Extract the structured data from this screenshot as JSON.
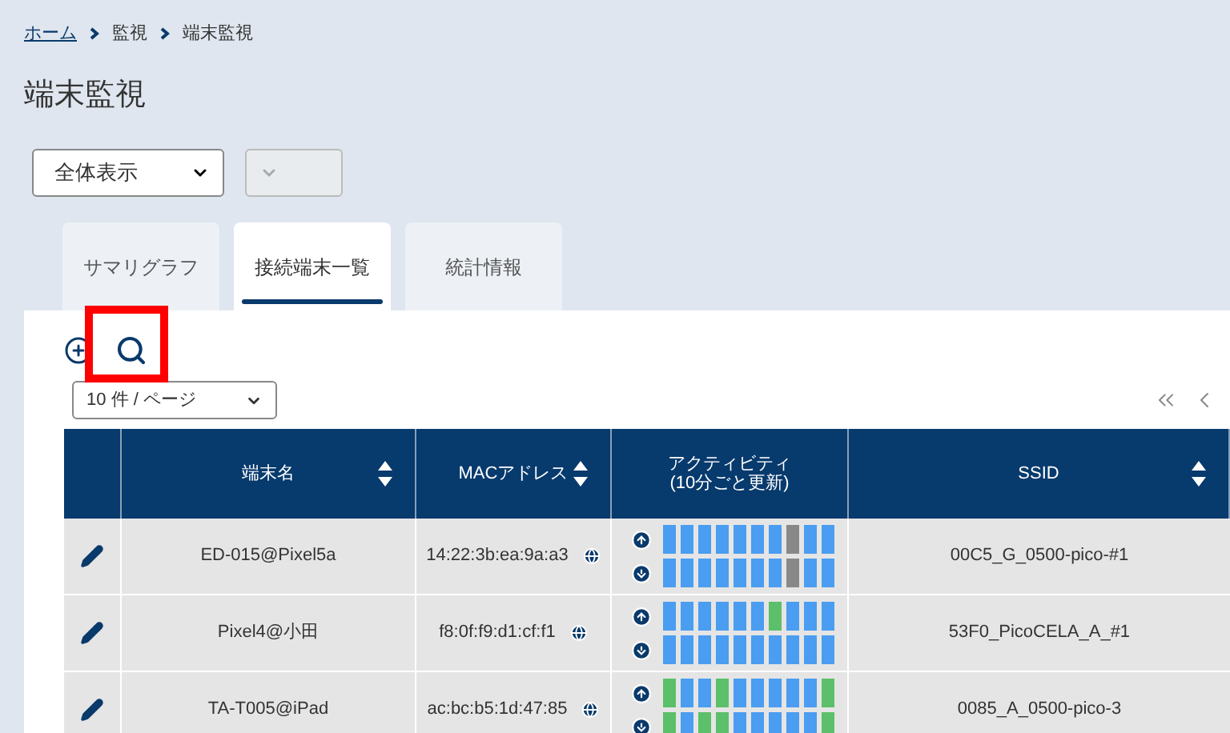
{
  "breadcrumb": [
    {
      "label": "ホーム",
      "link": true
    },
    {
      "label": "監視",
      "link": false
    },
    {
      "label": "端末監視",
      "link": false
    }
  ],
  "title": "端末監視",
  "filters": [
    {
      "value": "全体表示",
      "disabled": false
    },
    {
      "disabled": true
    }
  ],
  "tabs": [
    {
      "label": "サマリグラフ",
      "selected": false
    },
    {
      "label": "接続端末一覧",
      "selected": true
    },
    {
      "label": "統計情報",
      "selected": false
    }
  ],
  "page_size": "10 件 / ページ",
  "table": {
    "columns": [
      {
        "sortable": false
      },
      {
        "label": "端末名",
        "sortable": true
      },
      {
        "label": "MACアドレス",
        "sortable": true
      },
      {
        "label": "アクティビティ\n(10分ごと更新)",
        "sortable": false
      },
      {
        "label": "SSID",
        "sortable": true
      }
    ],
    "rows": [
      {
        "name": "ED-015@Pixel5a",
        "mac": "14:22:3b:ea:9a:a3",
        "ssid": "00C5_G_0500-pico-#1",
        "up": [
          {
            "color": "#4a9df0"
          },
          {
            "color": "#4a9df0"
          },
          {
            "color": "#4a9df0"
          },
          {
            "color": "#4a9df0"
          },
          {
            "color": "#4a9df0"
          },
          {
            "color": "#4a9df0"
          },
          {
            "color": "#4a9df0"
          },
          {
            "color": "#888888"
          },
          {
            "color": "#4a9df0"
          },
          {
            "color": "#4a9df0"
          }
        ],
        "down": [
          {
            "color": "#4a9df0"
          },
          {
            "color": "#4a9df0"
          },
          {
            "color": "#4a9df0"
          },
          {
            "color": "#4a9df0"
          },
          {
            "color": "#4a9df0"
          },
          {
            "color": "#4a9df0"
          },
          {
            "color": "#4a9df0"
          },
          {
            "color": "#888888"
          },
          {
            "color": "#4a9df0"
          },
          {
            "color": "#4a9df0"
          }
        ]
      },
      {
        "name": "Pixel4@小田",
        "mac": "f8:0f:f9:d1:cf:f1",
        "ssid": "53F0_PicoCELA_A_#1",
        "up": [
          {
            "color": "#4a9df0"
          },
          {
            "color": "#4a9df0"
          },
          {
            "color": "#4a9df0"
          },
          {
            "color": "#4a9df0"
          },
          {
            "color": "#4a9df0"
          },
          {
            "color": "#4a9df0"
          },
          {
            "color": "#5cbf6a"
          },
          {
            "color": "#4a9df0"
          },
          {
            "color": "#4a9df0"
          },
          {
            "color": "#4a9df0"
          }
        ],
        "down": [
          {
            "color": "#4a9df0"
          },
          {
            "color": "#4a9df0"
          },
          {
            "color": "#4a9df0"
          },
          {
            "color": "#4a9df0"
          },
          {
            "color": "#4a9df0"
          },
          {
            "color": "#4a9df0"
          },
          {
            "color": "#4a9df0"
          },
          {
            "color": "#4a9df0"
          },
          {
            "color": "#4a9df0"
          },
          {
            "color": "#4a9df0"
          }
        ]
      },
      {
        "name": "TA-T005@iPad",
        "mac": "ac:bc:b5:1d:47:85",
        "ssid": "0085_A_0500-pico-3",
        "up": [
          {
            "color": "#5cbf6a"
          },
          {
            "color": "#4a9df0"
          },
          {
            "color": "#4a9df0"
          },
          {
            "color": "#5cbf6a"
          },
          {
            "color": "#4a9df0"
          },
          {
            "color": "#4a9df0"
          },
          {
            "color": "#4a9df0"
          },
          {
            "color": "#4a9df0"
          },
          {
            "color": "#4a9df0"
          },
          {
            "color": "#5cbf6a"
          }
        ],
        "down": [
          {
            "color": "#5cbf6a"
          },
          {
            "color": "#4a9df0"
          },
          {
            "color": "#5cbf6a"
          },
          {
            "color": "#5cbf6a"
          },
          {
            "color": "#4a9df0"
          },
          {
            "color": "#4a9df0"
          },
          {
            "color": "#4a9df0"
          },
          {
            "color": "#4a9df0"
          },
          {
            "color": "#4a9df0"
          },
          {
            "color": "#5cbf6a"
          }
        ]
      }
    ]
  }
}
